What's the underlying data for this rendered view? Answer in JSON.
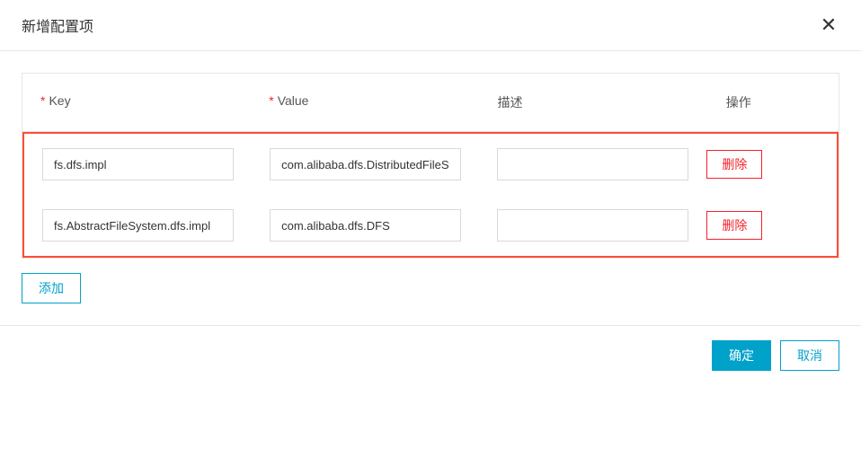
{
  "header": {
    "title": "新增配置项"
  },
  "table": {
    "headers": {
      "key": "Key",
      "value": "Value",
      "description": "描述",
      "action": "操作"
    },
    "required_mark": "*",
    "rows": [
      {
        "key": "fs.dfs.impl",
        "value": "com.alibaba.dfs.DistributedFileSystem",
        "description": ""
      },
      {
        "key": "fs.AbstractFileSystem.dfs.impl",
        "value": "com.alibaba.dfs.DFS",
        "description": ""
      }
    ]
  },
  "buttons": {
    "delete": "删除",
    "add": "添加",
    "confirm": "确定",
    "cancel": "取消"
  }
}
